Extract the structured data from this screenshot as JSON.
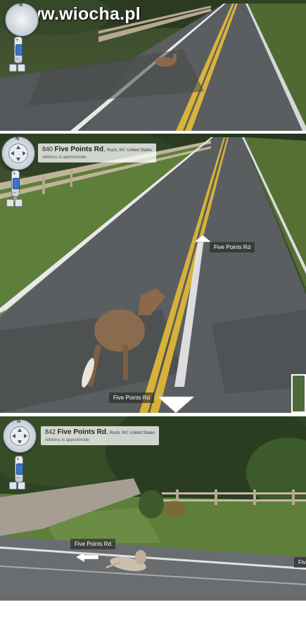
{
  "watermark": {
    "text": "www.wiocha.pl"
  },
  "panels": [
    {
      "compass_letter": "N"
    },
    {
      "address": {
        "number": "840",
        "street": "Five Points Rd",
        "city": "Rush, NY, United States",
        "note": "Address is approximate"
      },
      "compass_letter": "N",
      "road_labels": [
        "Five Points Rd",
        "Five Points Rd"
      ]
    },
    {
      "address": {
        "number": "842",
        "street": "Five Points Rd",
        "city": "Rush, NY, United States",
        "note": "Address is approximate"
      },
      "compass_letter": "N",
      "road_labels": [
        "Five Points Rd",
        "Fiv"
      ]
    }
  ],
  "icons": [
    "pan-compass-icon",
    "zoom-slider-icon",
    "fullscreen-icon",
    "navigation-arrow-icon"
  ],
  "colors": {
    "road": "#5b5e60",
    "center_line": "#d8b43a",
    "grass": "#5d7f3a",
    "trees": "#2f4424",
    "fence": "#b8a890"
  }
}
